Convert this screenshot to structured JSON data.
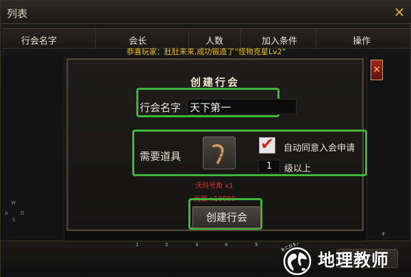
{
  "window": {
    "title": "列表",
    "close_glyph": "✕"
  },
  "columns": [
    "行会名字",
    "会长",
    "人数",
    "加入条件",
    "操作"
  ],
  "announcement": "恭喜玩家：肚肚来来,成功锻造了“怪物克星Lv2”",
  "dialog": {
    "title": "创建行会",
    "name_label": "行会名字",
    "name_value": "天下第一",
    "item_label": "需要道具",
    "item_icon": "horn-icon",
    "auto_approve_label": "自动同意入会申请",
    "auto_approve_checked": true,
    "level_value": "1",
    "level_suffix": "级以上",
    "req_item": "沃玛号角 x1",
    "req_gold": "元宝 x10000",
    "create_button": "创建行会",
    "close_glyph": "✕"
  },
  "compass": {
    "w": "W",
    "a": "A",
    "s": "S",
    "d": "D"
  },
  "hotbar": {
    "slots": [
      "1",
      "2",
      "3",
      "4",
      "5"
    ],
    "right_key": "F"
  },
  "watermark": {
    "text": "地理教师",
    "ring_text": "B.C.D.E.F"
  },
  "colors": {
    "highlight": "#3fb83a",
    "announcement": "#f0c020",
    "requirement": "#e53030",
    "accent": "#e0a040"
  }
}
